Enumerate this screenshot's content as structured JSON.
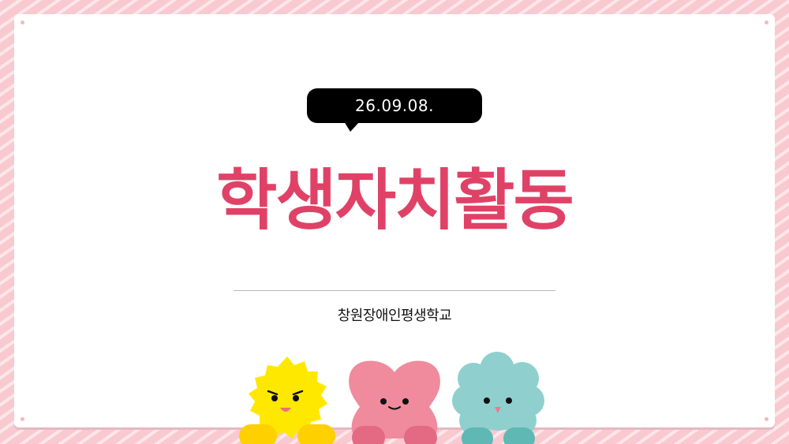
{
  "slide": {
    "date": "26.09.08.",
    "title": "학생자치활동",
    "school": "창원장애인평생학교"
  },
  "colors": {
    "background": "#f9c9d0",
    "stripe": "#fde6ea",
    "card": "#ffffff",
    "title": "#e04267",
    "bubble": "#000000",
    "yellow_character": "#ffe800",
    "pink_character": "#ef8b9c",
    "teal_character": "#8fd0cf"
  },
  "characters": {
    "left": "yellow-sun-character-icon",
    "middle": "pink-heart-character-icon",
    "right": "teal-cloud-character-icon"
  }
}
